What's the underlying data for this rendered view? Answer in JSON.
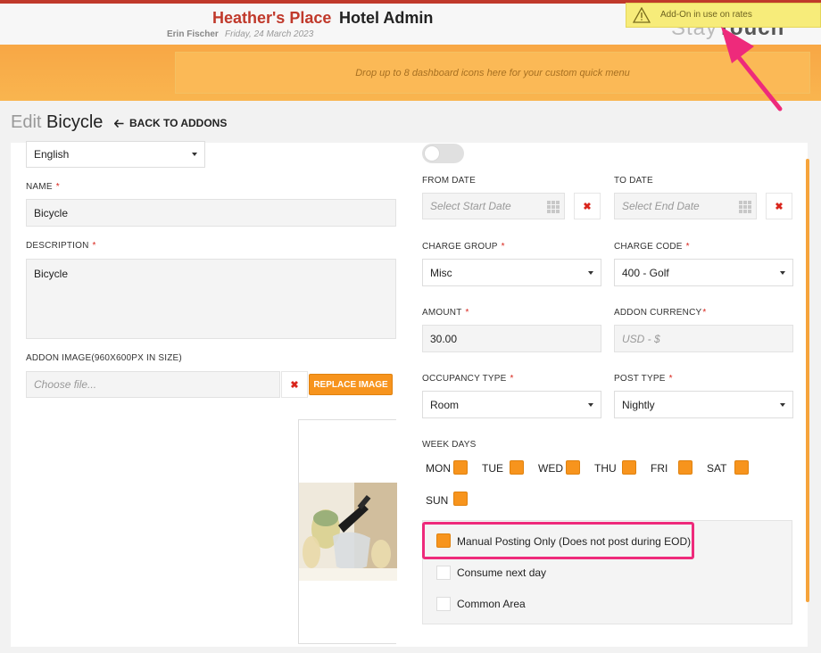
{
  "header": {
    "hotel_name": "Heather's Place",
    "app_name": "Hotel Admin",
    "user": "Erin Fischer",
    "date": "Friday, 24 March 2023",
    "notice": "Add-On in use on rates"
  },
  "quick_menu": {
    "drop_hint": "Drop up to 8 dashboard icons here for your custom quick menu"
  },
  "page": {
    "edit_prefix": "Edit",
    "title": "Bicycle",
    "back_label": "BACK TO ADDONS"
  },
  "form": {
    "language": "English",
    "name_label": "NAME",
    "name_value": "Bicycle",
    "description_label": "DESCRIPTION",
    "description_value": "Bicycle",
    "image_label": "ADDON IMAGE(960X600PX IN SIZE)",
    "file_placeholder": "Choose file...",
    "replace_label": "REPLACE IMAGE",
    "from_date_label": "FROM DATE",
    "from_date_placeholder": "Select Start Date",
    "to_date_label": "TO DATE",
    "to_date_placeholder": "Select End Date",
    "charge_group_label": "CHARGE GROUP",
    "charge_group_value": "Misc",
    "charge_code_label": "CHARGE CODE",
    "charge_code_value": "400 - Golf",
    "amount_label": "AMOUNT",
    "amount_value": "30.00",
    "currency_label": "ADDON CURRENCY",
    "currency_placeholder": "USD - $",
    "occupancy_label": "OCCUPANCY TYPE",
    "occupancy_value": "Room",
    "post_type_label": "POST TYPE",
    "post_type_value": "Nightly",
    "week_days_label": "WEEK DAYS",
    "week_days": [
      "MON",
      "TUE",
      "WED",
      "THU",
      "FRI",
      "SAT",
      "SUN"
    ],
    "options": [
      {
        "label": "Manual Posting Only (Does not post during EOD)",
        "checked": true
      },
      {
        "label": "Consume next day",
        "checked": false
      },
      {
        "label": "Common Area",
        "checked": false
      }
    ]
  },
  "colors": {
    "accent": "#f7941d",
    "brand_red": "#c0392b",
    "highlight": "#ee2a7b"
  }
}
